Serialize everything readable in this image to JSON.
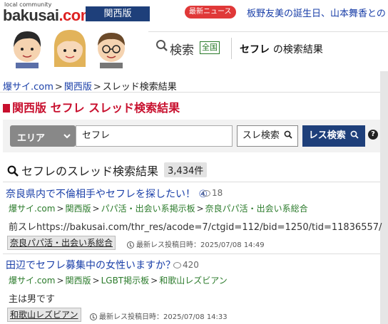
{
  "header": {
    "logo_small": "local community",
    "logo_brand": "bakusai",
    "logo_tld": ".com",
    "region_button": "関西版",
    "news_pill": "最新ニュース",
    "news_text": "板野友美の誕生日、山本舞香との"
  },
  "search_header": {
    "label": "検索",
    "scope_badge": "全国",
    "keyword": "セフレ",
    "suffix": "の検索結果"
  },
  "breadcrumb": {
    "items": [
      "爆サイ.com",
      "関西版"
    ],
    "separator": ">",
    "current": "スレッド検索結果"
  },
  "page_title": "関西版 セフレ スレッド検索結果",
  "search_form": {
    "area_label": "エリア",
    "keyword_value": "セフレ",
    "thread_search_button": "スレ検索",
    "res_search_button": "レス検索",
    "help": "?"
  },
  "results_summary": {
    "heading": "セフレのスレッド検索結果",
    "count": "3,434件"
  },
  "results": [
    {
      "title": "奈良県内で不倫相手やセフレを探したい！ ④",
      "comments": "18",
      "crumbs": [
        "爆サイ.com",
        "関西版",
        "パパ活・出会い系掲示板",
        "奈良パパ活・出会い系総合"
      ],
      "body": "前スレhttps://bakusai.com/thr_res/acode=7/ctgid=112/bid=1250/tid=11836557/",
      "tag": "奈良パパ活・出会い系総合",
      "date": "最新レス投稿日時：2025/07/08 14:49"
    },
    {
      "title": "田辺でセフレ募集中の女性いますか？",
      "comments": "420",
      "crumbs": [
        "爆サイ.com",
        "関西版",
        "LGBT掲示板",
        "和歌山レズビアン"
      ],
      "body": "主は男です",
      "tag": "和歌山レズビアン",
      "date": "最新レス投稿日時：2025/07/08 14:33"
    }
  ],
  "colors": {
    "brand_navy": "#1e3f7a",
    "accent_red": "#c8102e",
    "link_blue": "#1a3fa8",
    "crumb_green": "#2a7a2a"
  }
}
